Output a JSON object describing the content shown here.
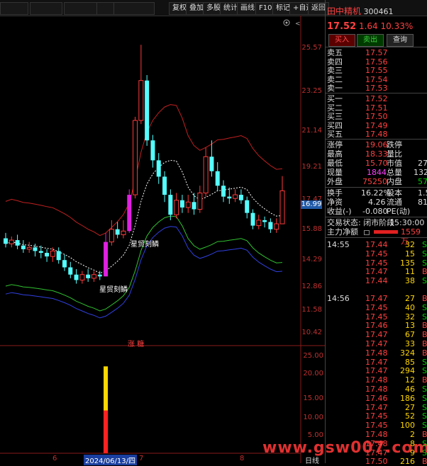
{
  "toolbar": {
    "items": [
      "复权",
      "叠加",
      "多股",
      "统计",
      "画线",
      "F10",
      "标记",
      "+自选",
      "返回"
    ]
  },
  "stock": {
    "name": "田中精机",
    "code": "300461",
    "price": "17.52",
    "change": "1.64",
    "pct": "10.33%",
    "buy_btn": "买入",
    "sell_btn": "卖出",
    "query_btn": "查询"
  },
  "order_book": {
    "asks": [
      {
        "label": "卖五",
        "price": "17.57"
      },
      {
        "label": "卖四",
        "price": "17.56"
      },
      {
        "label": "卖三",
        "price": "17.55"
      },
      {
        "label": "卖二",
        "price": "17.54"
      },
      {
        "label": "卖一",
        "price": "17.53"
      }
    ],
    "bids": [
      {
        "label": "买一",
        "price": "17.52"
      },
      {
        "label": "买二",
        "price": "17.51"
      },
      {
        "label": "买三",
        "price": "17.50"
      },
      {
        "label": "买四",
        "price": "17.49"
      },
      {
        "label": "买五",
        "price": "17.48"
      }
    ]
  },
  "stats": {
    "zt_label": "涨停",
    "zt": "19.06",
    "dt_label": "跌停",
    "high_label": "最高",
    "high": "18.33",
    "lb_label": "量比",
    "low_label": "最低",
    "low": "15.70",
    "sz_label": "市值",
    "sz": "27",
    "cur_label": "现量",
    "cur": "1844",
    "zl_label": "总量",
    "zl": "132",
    "wp_label": "外盘",
    "wp": "75250",
    "np_label": "内盘",
    "np": "57",
    "hs_label": "换手",
    "hs": "16.22%",
    "gb_label": "股本",
    "gb": "1.5",
    "jz_label": "净资",
    "jz": "4.26",
    "lt_label": "流通",
    "lt": "81",
    "sy_label": "收益(-)",
    "sy": "-0.080",
    "pe_label": "PE(动)"
  },
  "status": {
    "label": "交易状态:",
    "value": "闭市阶段",
    "time": "15:30:00",
    "flow_label": "主力净额",
    "flow": "1559万"
  },
  "ticks": [
    {
      "t": "14:55",
      "p": "17.44",
      "v": "32",
      "d": "S"
    },
    {
      "t": "",
      "p": "17.45",
      "v": "15",
      "d": "S"
    },
    {
      "t": "",
      "p": "17.45",
      "v": "135",
      "d": "S"
    },
    {
      "t": "",
      "p": "17.47",
      "v": "11",
      "d": "B"
    },
    {
      "t": "",
      "p": "17.44",
      "v": "38",
      "d": "S"
    },
    {
      "t": "14:56",
      "p": "17.47",
      "v": "27",
      "d": "B"
    },
    {
      "t": "",
      "p": "17.45",
      "v": "40",
      "d": "S"
    },
    {
      "t": "",
      "p": "17.45",
      "v": "32",
      "d": "S"
    },
    {
      "t": "",
      "p": "17.46",
      "v": "13",
      "d": "B"
    },
    {
      "t": "",
      "p": "17.47",
      "v": "67",
      "d": "B"
    },
    {
      "t": "",
      "p": "17.47",
      "v": "33",
      "d": "B"
    },
    {
      "t": "",
      "p": "17.48",
      "v": "324",
      "d": "B"
    },
    {
      "t": "",
      "p": "17.47",
      "v": "85",
      "d": "S"
    },
    {
      "t": "",
      "p": "17.47",
      "v": "294",
      "d": "S"
    },
    {
      "t": "",
      "p": "17.48",
      "v": "12",
      "d": "B"
    },
    {
      "t": "",
      "p": "17.48",
      "v": "46",
      "d": "S"
    },
    {
      "t": "",
      "p": "17.46",
      "v": "186",
      "d": "S"
    },
    {
      "t": "",
      "p": "17.47",
      "v": "27",
      "d": "S"
    },
    {
      "t": "",
      "p": "17.45",
      "v": "52",
      "d": "S"
    },
    {
      "t": "",
      "p": "17.45",
      "v": "100",
      "d": "S"
    },
    {
      "t": "",
      "p": "17.48",
      "v": "2",
      "d": "B"
    },
    {
      "t": "",
      "p": "17.48",
      "v": "8",
      "d": "S"
    },
    {
      "t": "",
      "p": "17.47",
      "v": "9",
      "d": "S"
    },
    {
      "t": "",
      "p": "17.50",
      "v": "216",
      "d": "B"
    }
  ],
  "chart": {
    "price_ticks": [
      "25.57",
      "23.25",
      "21.14",
      "19.21",
      "17.47",
      "15.88",
      "14.29",
      "12.86",
      "11.58",
      "10.42"
    ],
    "cur_price_tag": "16.99",
    "vol_ticks": [
      "25.00",
      "20.00",
      "15.00",
      "10.00",
      "5.00"
    ],
    "date_labels": [
      "6",
      "2024/06/13/四",
      "7",
      "8"
    ],
    "day_label": "日线",
    "signal1": "星贸刻鳞",
    "signal2": "星贸刻鳞",
    "zt_badge": "涨 糖",
    "watermark": "www.gsw007.com"
  },
  "chart_data": {
    "type": "candlestick",
    "candles": [
      {
        "o": 14.9,
        "c": 14.6,
        "h": 15.2,
        "l": 14.4
      },
      {
        "o": 14.6,
        "c": 14.8,
        "h": 15.0,
        "l": 14.4
      },
      {
        "o": 14.8,
        "c": 14.5,
        "h": 15.1,
        "l": 14.3
      },
      {
        "o": 14.5,
        "c": 14.3,
        "h": 14.8,
        "l": 14.1
      },
      {
        "o": 14.3,
        "c": 14.4,
        "h": 14.7,
        "l": 14.1
      },
      {
        "o": 14.4,
        "c": 14.2,
        "h": 14.6,
        "l": 13.9
      },
      {
        "o": 14.2,
        "c": 14.1,
        "h": 14.5,
        "l": 13.8
      },
      {
        "o": 14.1,
        "c": 13.9,
        "h": 14.3,
        "l": 13.6
      },
      {
        "o": 13.9,
        "c": 14.2,
        "h": 14.4,
        "l": 13.6
      },
      {
        "o": 14.2,
        "c": 13.7,
        "h": 14.4,
        "l": 13.5
      },
      {
        "o": 13.7,
        "c": 13.3,
        "h": 14.0,
        "l": 13.1
      },
      {
        "o": 13.3,
        "c": 12.9,
        "h": 13.6,
        "l": 12.7
      },
      {
        "o": 12.9,
        "c": 12.6,
        "h": 13.2,
        "l": 12.4
      },
      {
        "o": 12.6,
        "c": 12.9,
        "h": 13.1,
        "l": 12.4
      },
      {
        "o": 12.9,
        "c": 12.7,
        "h": 13.2,
        "l": 12.5
      },
      {
        "o": 12.7,
        "c": 12.9,
        "h": 13.1,
        "l": 12.5
      },
      {
        "o": 12.9,
        "c": 12.8,
        "h": 13.1,
        "l": 12.6
      },
      {
        "o": 12.8,
        "c": 14.7,
        "h": 15.2,
        "l": 12.8,
        "zt": true
      },
      {
        "o": 14.7,
        "c": 15.4,
        "h": 15.9,
        "l": 14.5
      },
      {
        "o": 15.4,
        "c": 15.1,
        "h": 15.8,
        "l": 14.9
      },
      {
        "o": 15.1,
        "c": 15.3,
        "h": 15.9,
        "l": 14.9
      },
      {
        "o": 15.3,
        "c": 17.3,
        "h": 17.6,
        "l": 15.2,
        "zt": true
      },
      {
        "o": 17.3,
        "c": 21.4,
        "h": 21.6,
        "l": 17.1
      },
      {
        "o": 21.4,
        "c": 23.6,
        "h": 25.57,
        "l": 21.2
      },
      {
        "o": 23.6,
        "c": 20.3,
        "h": 23.9,
        "l": 20.0
      },
      {
        "o": 20.3,
        "c": 19.2,
        "h": 20.6,
        "l": 18.8
      },
      {
        "o": 19.2,
        "c": 18.3,
        "h": 19.6,
        "l": 17.9
      },
      {
        "o": 18.3,
        "c": 17.3,
        "h": 18.6,
        "l": 16.9
      },
      {
        "o": 17.3,
        "c": 16.2,
        "h": 17.6,
        "l": 15.9
      },
      {
        "o": 16.2,
        "c": 17.0,
        "h": 17.4,
        "l": 16.0
      },
      {
        "o": 17.0,
        "c": 16.6,
        "h": 17.3,
        "l": 16.3
      },
      {
        "o": 16.6,
        "c": 16.9,
        "h": 17.3,
        "l": 16.3
      },
      {
        "o": 16.9,
        "c": 16.5,
        "h": 17.4,
        "l": 16.2
      },
      {
        "o": 16.5,
        "c": 17.4,
        "h": 17.8,
        "l": 16.3
      },
      {
        "o": 17.4,
        "c": 19.4,
        "h": 19.9,
        "l": 17.2
      },
      {
        "o": 19.4,
        "c": 18.6,
        "h": 20.3,
        "l": 18.3
      },
      {
        "o": 18.6,
        "c": 17.8,
        "h": 19.1,
        "l": 17.5
      },
      {
        "o": 17.8,
        "c": 17.2,
        "h": 18.1,
        "l": 16.9
      },
      {
        "o": 17.2,
        "c": 17.1,
        "h": 17.7,
        "l": 16.8
      },
      {
        "o": 17.1,
        "c": 17.3,
        "h": 17.6,
        "l": 16.9
      },
      {
        "o": 17.3,
        "c": 17.0,
        "h": 17.6,
        "l": 16.8
      },
      {
        "o": 17.0,
        "c": 16.3,
        "h": 17.2,
        "l": 16.0
      },
      {
        "o": 16.3,
        "c": 15.6,
        "h": 16.5,
        "l": 15.4
      },
      {
        "o": 15.6,
        "c": 15.9,
        "h": 16.2,
        "l": 15.4
      },
      {
        "o": 15.9,
        "c": 15.8,
        "h": 16.1,
        "l": 15.5
      },
      {
        "o": 15.8,
        "c": 15.4,
        "h": 16.0,
        "l": 15.2
      },
      {
        "o": 15.4,
        "c": 15.7,
        "h": 16.0,
        "l": 15.2
      },
      {
        "o": 15.7,
        "c": 17.52,
        "h": 18.33,
        "l": 15.7
      }
    ],
    "volume_last": [
      24.0,
      4.0
    ],
    "ylim": [
      10.0,
      26.4
    ]
  }
}
